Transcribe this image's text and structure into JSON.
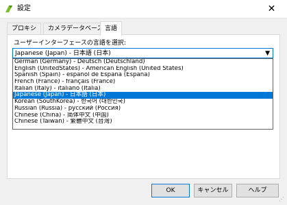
{
  "window": {
    "title": "設定",
    "close_glyph": "✕"
  },
  "tabs": [
    {
      "label": "プロキシ"
    },
    {
      "label": "カメラデータベース"
    },
    {
      "label": "言語",
      "active": true
    }
  ],
  "language": {
    "label": "ユーザーインターフェースの言語を選択:",
    "selected": "Japanese (Japan) - 日本語 (日本)",
    "options": [
      "German (Germany) - Deutsch (Deutschland)",
      "English (UnitedStates) - American English (United States)",
      "Spanish (Spain) - español de España (España)",
      "French (France) - français (France)",
      "Italian (Italy) - italiano (Italia)",
      "Japanese (Japan) - 日本語 (日本)",
      "Korean (SouthKorea) - 한국어 (대한민국)",
      "Russian (Russia) - русский (Россия)",
      "Chinese (China) - 简体中文 (中国)",
      "Chinese (Taiwan) - 繁體中文 (台灣)"
    ]
  },
  "buttons": {
    "ok": "OK",
    "cancel": "キャンセル",
    "help": "ヘルプ"
  },
  "colors": {
    "accent": "#0078d7",
    "app_icon": "#7cbf2e"
  }
}
